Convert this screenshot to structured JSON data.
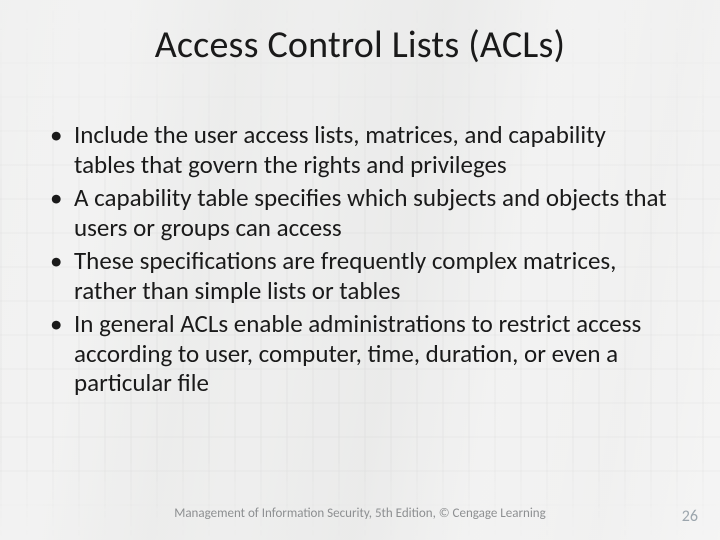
{
  "title": "Access Control Lists (ACLs)",
  "bullets": [
    "Include the user access lists, matrices, and capability tables that govern the rights and privileges",
    "A capability table specifies which subjects and objects that users or groups can access",
    "These specifications are frequently complex matrices, rather than simple lists or tables",
    "In general ACLs enable administrations to restrict access according to user, computer, time, duration, or even a particular file"
  ],
  "footer": "Management of Information Security, 5th Edition, © Cengage Learning",
  "page_number": "26"
}
